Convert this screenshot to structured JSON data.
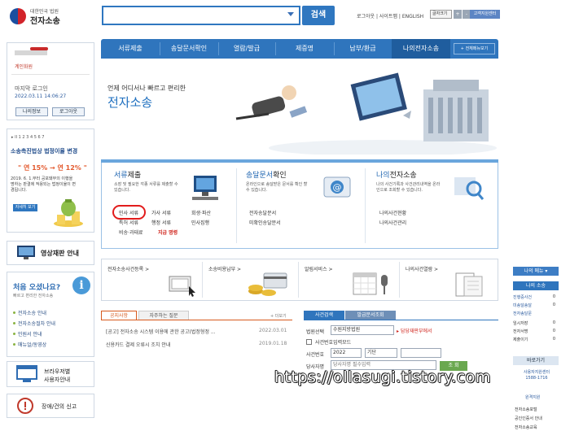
{
  "header": {
    "logo_sub": "대한민국 법원",
    "logo_main": "전자소송",
    "search_placeholder": "",
    "search_button": "검색",
    "top_links": "로그아웃 | 사이트맵 | ENGLISH",
    "font_size_label": "글자크기",
    "font_up": "+",
    "font_down": "-",
    "admin_link": "고객지원센터"
  },
  "nav": {
    "items": [
      "서류제출",
      "송달문서확인",
      "열람/발급",
      "제증명",
      "납부/환급",
      "나의전자소송"
    ],
    "more": "+ 전체메뉴보기"
  },
  "login": {
    "link": "계인화원",
    "last_login_label": "마지막 로그인",
    "last_login_time": "2022.03.11 14:06:27",
    "my_info_button": "나의정보",
    "logout_button": "로그아웃"
  },
  "promo": {
    "controls": "▸ II  1 2 3 4 5 6 7",
    "title": "소송촉진법상 법정이율 변경",
    "rate_change": "\" 연 15% → 연 12% \"",
    "body": "2019. 6. 1.부터 공포돼부의 이행을 명하는 판결에 적용되는 법정이율이 변경됩니다.",
    "button": "자세히 보기"
  },
  "video": {
    "title": "영상재판 안내"
  },
  "first_visit": {
    "title": "처음 오셨나요?",
    "subtitle": "빠르고 편리한 전자소송",
    "items": [
      "전자소송 안내",
      "전자소송절차 안내",
      "민원서 안내",
      "매뉴얼/동영상"
    ]
  },
  "browser": {
    "title_line1": "브라우저별",
    "title_line2": "사용자안내"
  },
  "error": {
    "title": "장애/건의 신고"
  },
  "banner": {
    "subtitle": "언제 어디서나 빠르고 편리한",
    "title": "전자소송"
  },
  "services": {
    "submit": {
      "title_a": "서류",
      "title_b": "제출",
      "desc": "소장 및 필요한 각종 서류를 제출할 수 있습니다.",
      "links": [
        "민사 서류",
        "가사 서류",
        "회생·파산",
        "특허 서류",
        "행정 서류",
        "민사집행",
        "비송·과태료",
        "지급 명령"
      ]
    },
    "delivery": {
      "title_a": "송달문서",
      "title_b": "확인",
      "desc": "온라인으로 송달받은 문서를 확인 할 수 있습니다.",
      "links": [
        "전자송달문서",
        "미확인송달문서"
      ]
    },
    "my": {
      "title_a": "나의",
      "title_b": "전자소송",
      "desc": "나의 사건기록과 사건관리내역을 온라인으로 조회할 수 있습니다.",
      "links": [
        "나의사건현황",
        "나의사건관리"
      ]
    }
  },
  "quick": [
    "전자소송사건등록 >",
    "소송비용납부 >",
    "알림서비스 >",
    "나의사건열람 >"
  ],
  "notices": {
    "tab_notice": "공지사항",
    "tab_faq": "자주하는 질문",
    "more": "+ 더보기",
    "rows": [
      {
        "text": "[공고] 전자소송 시스템 이용에 관한 공고(법정형정 ...",
        "date": "2022.03.01"
      },
      {
        "text": "신용카드 결제 오류시 조치 안내",
        "date": "2019.01.18"
      }
    ]
  },
  "case_search": {
    "tab_search": "사건검색",
    "tab_delivery": "발급문서조회",
    "court_label": "법원선택",
    "court_value": "수원지방법원",
    "court_link": "▸ 담당재판부에서",
    "checkbox_label": "사건번호입력모드",
    "case_no_label": "사건번호",
    "year_value": "2022",
    "type_value": "기단",
    "party_label": "당사자명",
    "party_placeholder": "당사자명 필수입력",
    "search_button": "조 회"
  },
  "right_sidebar": {
    "my_menu": "나의 메뉴 ▾",
    "my_case": "나의 소송",
    "items": [
      {
        "label": "진행중사건",
        "count": "0"
      },
      {
        "label": "미송달송달",
        "count": "0"
      },
      {
        "label": "전자송달문",
        "count": ""
      },
      {
        "label": "임시저장",
        "count": "0"
      },
      {
        "label": "전자서명",
        "count": "0"
      },
      {
        "label": "제출이기",
        "count": "0"
      }
    ],
    "shortcut": "바로가기",
    "support_line1": "사용자지원센터",
    "support_line2": "1588-1716",
    "remote": "원격지원",
    "bottom": [
      "전자소송포털",
      "공인인증서 안내",
      "전자소송교육"
    ]
  },
  "watermark": "https://ollasugi.tistory.com"
}
